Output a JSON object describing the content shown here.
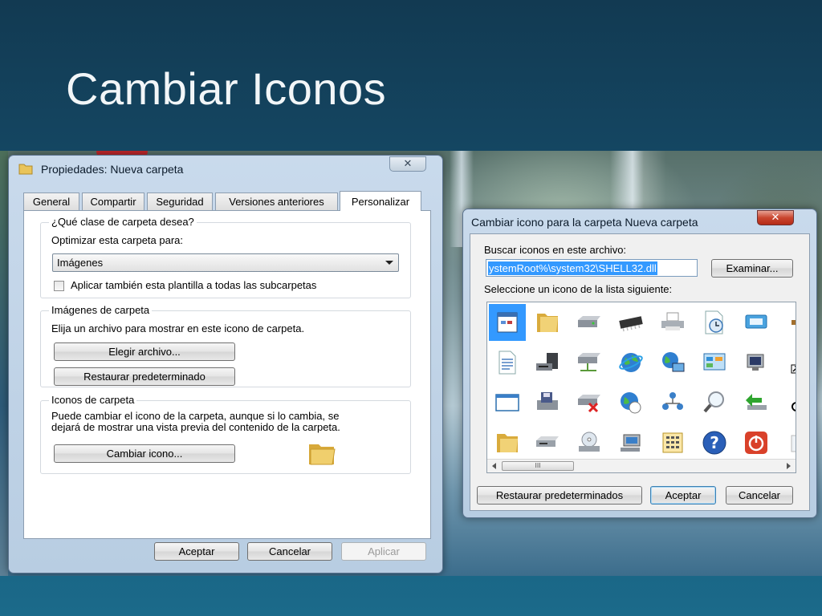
{
  "slide": {
    "title": "Cambiar Iconos"
  },
  "props_window": {
    "title": "Propiedades: Nueva carpeta",
    "close_glyph": "✕",
    "tabs": [
      {
        "label": "General",
        "active": false
      },
      {
        "label": "Compartir",
        "active": false
      },
      {
        "label": "Seguridad",
        "active": false
      },
      {
        "label": "Versiones anteriores",
        "active": false
      },
      {
        "label": "Personalizar",
        "active": true
      }
    ],
    "folder_type": {
      "group_label": "¿Qué clase de carpeta desea?",
      "optimize_label": "Optimizar esta carpeta para:",
      "optimize_value": "Imágenes",
      "apply_subfolders_label": "Aplicar también esta plantilla a todas las subcarpetas",
      "apply_subfolders_checked": false
    },
    "folder_pictures": {
      "group_label": "Imágenes de carpeta",
      "description": "Elija un archivo para mostrar en este icono de carpeta.",
      "choose_file_button": "Elegir archivo...",
      "restore_default_button": "Restaurar predeterminado"
    },
    "folder_icons": {
      "group_label": "Iconos de carpeta",
      "description_line1": "Puede cambiar el icono de la carpeta, aunque si lo cambia, se",
      "description_line2": "dejará de mostrar una vista previa del contenido de la carpeta.",
      "change_icon_button": "Cambiar icono...",
      "preview_icon": "folder-icon"
    },
    "footer": {
      "ok_button": "Aceptar",
      "cancel_button": "Cancelar",
      "apply_button": "Aplicar"
    }
  },
  "change_icon_dialog": {
    "title": "Cambiar icono para la carpeta Nueva carpeta",
    "close_glyph": "✕",
    "search_label": "Buscar iconos en este archivo:",
    "file_path_value": "ystemRoot%\\system32\\SHELL32.dll",
    "browse_button": "Examinar...",
    "list_label": "Seleccione un icono de la lista siguiente:",
    "scroll_thumb_glyph": "III",
    "icons": [
      "application-window-icon",
      "folder-icon",
      "hard-drive-icon",
      "memory-chip-icon",
      "printer-icon",
      "clock-document-icon",
      "window-monitor-icon",
      "text-document-icon",
      "server-icon",
      "network-drive-icon",
      "globe-icon",
      "network-globe-icon",
      "control-panel-icon",
      "monitor-icon",
      "blank-window-icon",
      "floppy-disk-icon",
      "disconnected-drive-icon",
      "globe-download-icon",
      "network-users-icon",
      "search-icon",
      "green-arrow-icon",
      "open-folder-icon",
      "removable-drive-icon",
      "cd-drive-icon",
      "monitor-network-icon",
      "calculator-icon",
      "help-icon",
      "power-icon"
    ],
    "selected_icon_index": 0,
    "restore_defaults_button": "Restaurar predeterminados",
    "ok_button": "Aceptar",
    "cancel_button": "Cancelar"
  },
  "colors": {
    "slide_background": "#16506f",
    "selection": "#3399ff",
    "close_button_red": "#c9462f"
  }
}
